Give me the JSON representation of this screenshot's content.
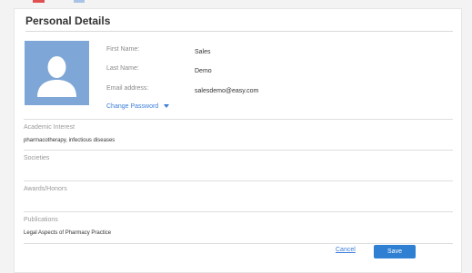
{
  "page": {
    "title": "Personal Details"
  },
  "profile": {
    "first_name_label": "First Name:",
    "first_name_value": "Sales",
    "last_name_label": "Last Name:",
    "last_name_value": "Demo",
    "email_label": "Email address:",
    "email_value": "salesdemo@easy.com",
    "change_password_label": "Change Password"
  },
  "sections": {
    "academic_interest": {
      "title": "Academic Interest",
      "value": "pharmacotherapy, infectious diseases"
    },
    "societies": {
      "title": "Societies",
      "value": ""
    },
    "awards": {
      "title": "Awards/Honors",
      "value": ""
    },
    "publications": {
      "title": "Publications",
      "value": "Legal Aspects of Pharmacy Practice"
    }
  },
  "actions": {
    "cancel_label": "Cancel",
    "save_label": "Save"
  },
  "colors": {
    "accent": "#3b7dd8",
    "save_button": "#2f7fd3",
    "avatar_bg": "#7ea6d6"
  },
  "icons": {
    "avatar": "user-silhouette-icon",
    "caret": "caret-down-icon"
  }
}
